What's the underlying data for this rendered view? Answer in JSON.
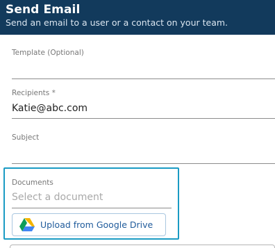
{
  "header": {
    "title": "Send Email",
    "subtitle": "Send an email to a user or a contact on your team."
  },
  "form": {
    "template": {
      "label": "Template (Optional)",
      "value": ""
    },
    "recipients": {
      "label": "Recipients *",
      "value": "Katie@abc.com"
    },
    "subject": {
      "label": "Subject",
      "value": ""
    },
    "documents": {
      "label": "Documents",
      "placeholder": "Select a document",
      "upload_label": "Upload from Google Drive",
      "upload_icon": "google-drive-icon"
    }
  },
  "colors": {
    "header_bg": "#123a5c",
    "highlight": "#1a9bc4",
    "button_text": "#1f5b9b"
  }
}
